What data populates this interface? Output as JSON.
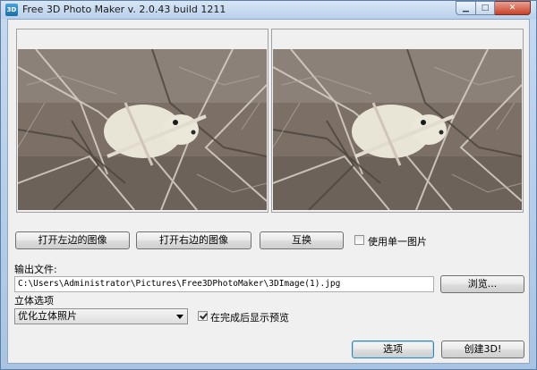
{
  "window": {
    "title": "Free 3D Photo Maker  v. 2.0.43 build 1211",
    "icon_text": "3D"
  },
  "title_controls": {
    "minimize": "▁",
    "maximize": "□",
    "close": "✕"
  },
  "buttons": {
    "open_left": "打开左边的图像",
    "open_right": "打开右边的图像",
    "swap": "互换",
    "browse": "浏览...",
    "options": "选项",
    "create": "创建3D!"
  },
  "single_image": {
    "label": "使用单一图片",
    "checked": false
  },
  "output": {
    "label": "输出文件:",
    "path": "C:\\Users\\Administrator\\Pictures\\Free3DPhotoMaker\\3DImage(1).jpg"
  },
  "stereo": {
    "label": "立体选项",
    "selected": "优化立体照片"
  },
  "preview": {
    "label": "在完成后显示预览",
    "checked": true
  },
  "images": {
    "left_icon": "hyrax-photo",
    "right_icon": "hyrax-photo"
  }
}
